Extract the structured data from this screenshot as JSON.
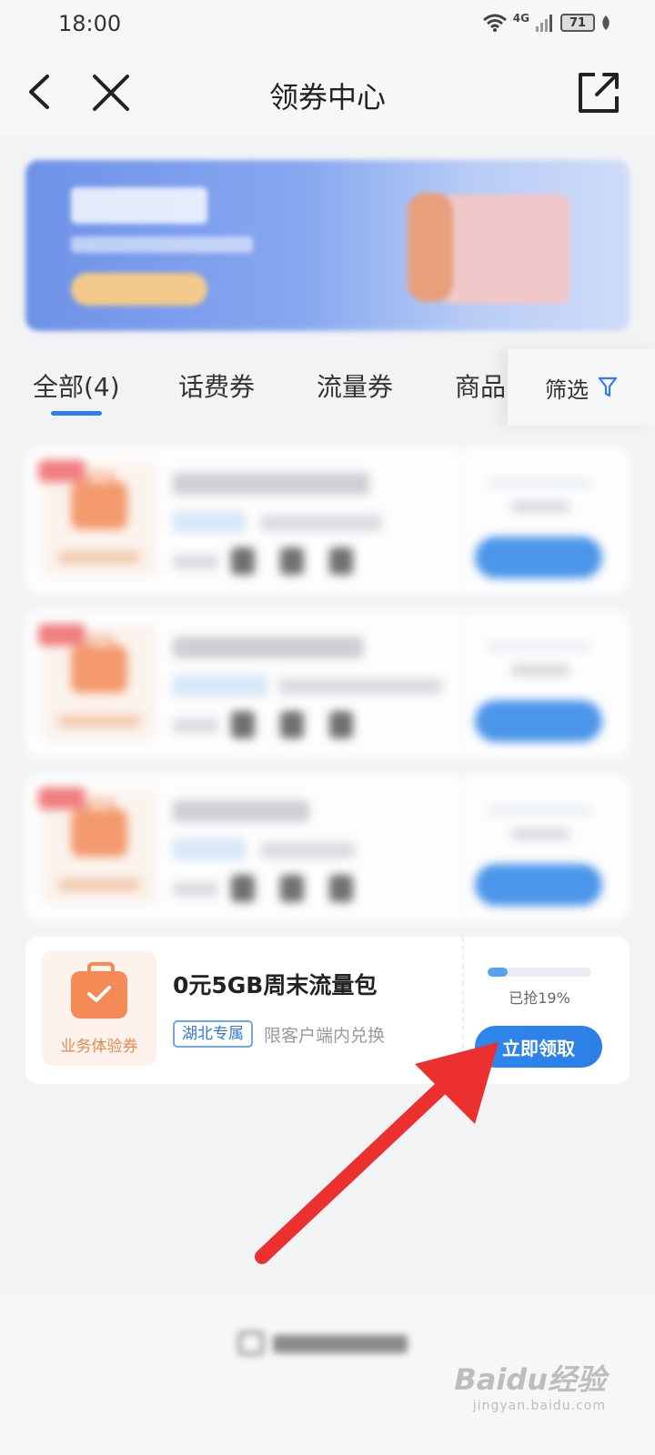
{
  "status_bar": {
    "time": "18:00",
    "network": "4G",
    "battery": "71"
  },
  "nav": {
    "title": "领券中心",
    "back_icon": "chevron-left-icon",
    "close_icon": "close-icon",
    "share_icon": "share-icon"
  },
  "tabs": {
    "items": [
      "全部(4)",
      "话费券",
      "流量券",
      "商品"
    ],
    "active": 0,
    "filter_label": "筛选"
  },
  "coupons": [
    {
      "name": "0元5GB周末流量包",
      "category": "业务体验券",
      "region_tag": "湖北专属",
      "note": "限客户端内兑换",
      "progress": 0.19,
      "progress_label": "已抢19%",
      "button": "立即领取"
    }
  ],
  "watermark": {
    "brand": "Baidu经验",
    "site": "jingyan.baidu.com"
  },
  "colors": {
    "accent": "#2f7df3",
    "coupon_orange": "#f48a55",
    "annotation_arrow": "#ec2f2f"
  }
}
